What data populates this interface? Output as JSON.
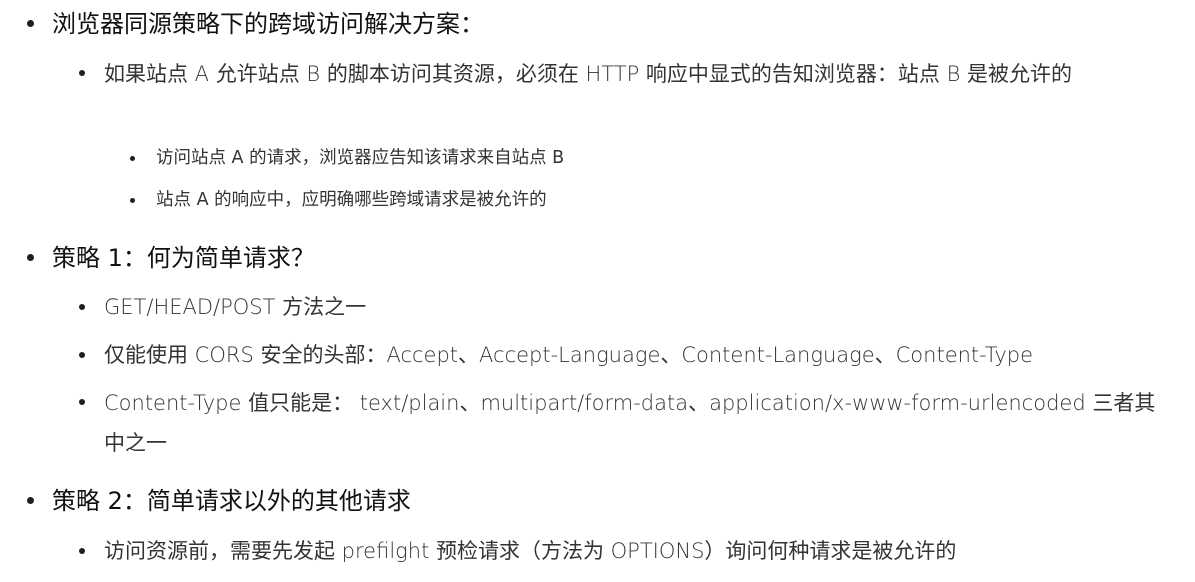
{
  "sections": [
    {
      "title": "浏览器同源策略下的跨域访问解决方案：",
      "items": [
        {
          "text": "如果站点 A 允许站点 B 的脚本访问其资源，必须在 HTTP 响应中显式的告知浏览器：站点 B 是被允许的",
          "subitems": [
            "访问站点 A 的请求，浏览器应告知该请求来自站点 B",
            "站点 A 的响应中，应明确哪些跨域请求是被允许的"
          ]
        }
      ]
    },
    {
      "title": "策略 1：何为简单请求？",
      "items": [
        {
          "text": "GET/HEAD/POST 方法之一"
        },
        {
          "text": "仅能使用 CORS 安全的头部：Accept、Accept-Language、Content-Language、Content-Type"
        },
        {
          "text": "Content-Type 值只能是： text/plain、multipart/form-data、application/x-www-form-urlencoded 三者其中之一"
        }
      ]
    },
    {
      "title": "策略 2：简单请求以外的其他请求",
      "items": [
        {
          "text": "访问资源前，需要先发起 prefilght 预检请求（方法为 OPTIONS）询问何种请求是被允许的"
        }
      ]
    }
  ]
}
